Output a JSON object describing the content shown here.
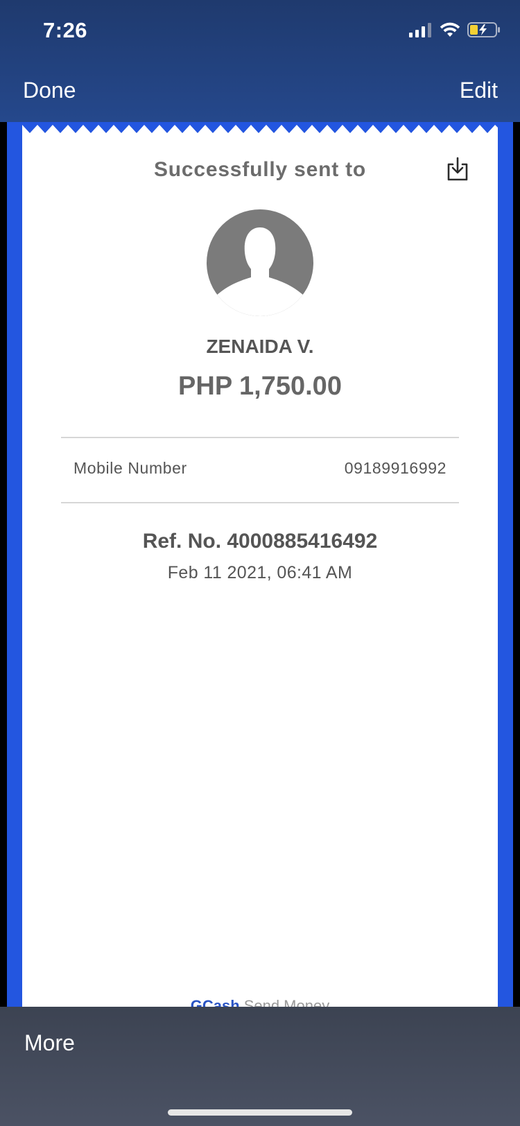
{
  "status_bar": {
    "time": "7:26"
  },
  "nav": {
    "done_label": "Done",
    "edit_label": "Edit"
  },
  "receipt": {
    "title": "Successfully sent to",
    "recipient_name": "ZENAIDA V.",
    "amount": "PHP 1,750.00",
    "details": {
      "label": "Mobile Number",
      "value": "09189916992"
    },
    "reference": "Ref. No. 4000885416492",
    "date": "Feb 11 2021, 06:41 AM",
    "footer_brand": "GCash",
    "footer_label": "Send Money"
  },
  "bottom_bar": {
    "more_label": "More"
  },
  "colors": {
    "nav_background": "#25488c",
    "document_border": "#2356e0",
    "brand_blue": "#2a54c4"
  },
  "icons": {
    "download": "download-icon",
    "avatar": "user-placeholder-icon"
  }
}
